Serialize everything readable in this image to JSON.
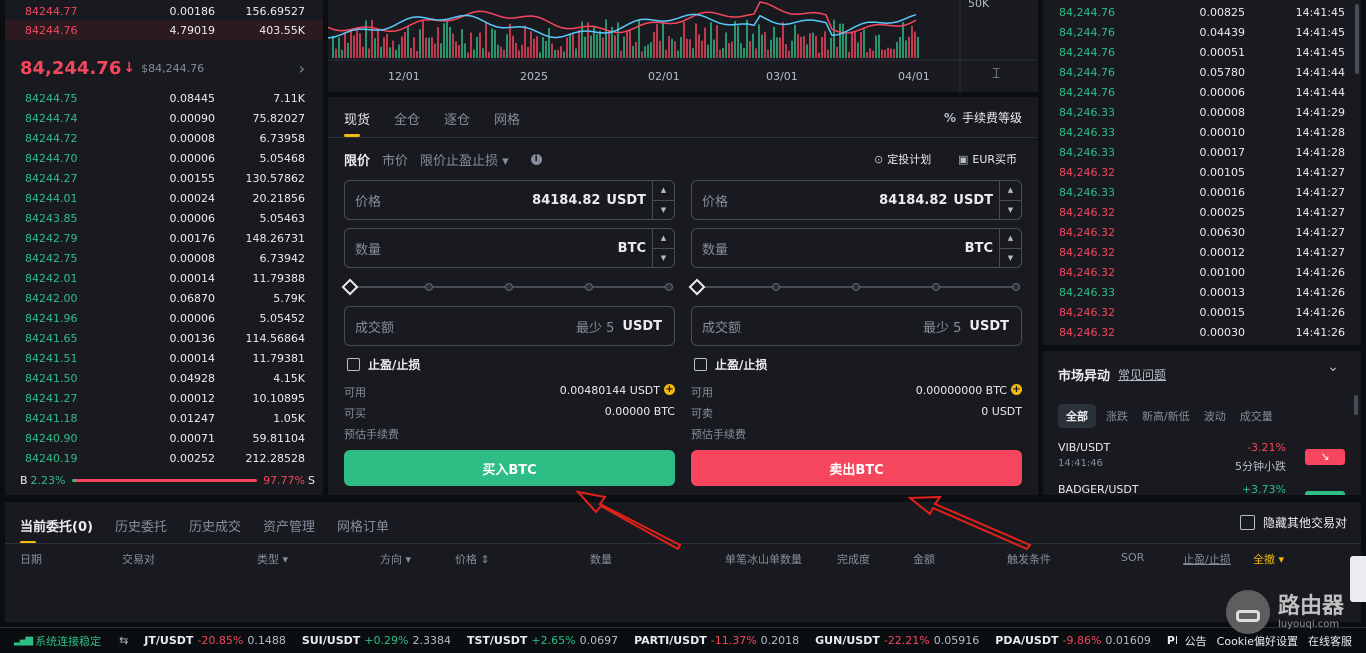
{
  "orderbook": {
    "top_asks": [
      {
        "price": "84244.77",
        "qty": "0.00186",
        "total": "156.69527"
      },
      {
        "price": "84244.76",
        "qty": "4.79019",
        "total": "403.55K"
      }
    ],
    "last_price": "84,244.76",
    "last_arrow": "↓",
    "last_fiat": "$84,244.76",
    "chevron": "›",
    "bids": [
      {
        "price": "84244.75",
        "qty": "0.08445",
        "total": "7.11K"
      },
      {
        "price": "84244.74",
        "qty": "0.00090",
        "total": "75.82027"
      },
      {
        "price": "84244.72",
        "qty": "0.00008",
        "total": "6.73958"
      },
      {
        "price": "84244.70",
        "qty": "0.00006",
        "total": "5.05468"
      },
      {
        "price": "84244.27",
        "qty": "0.00155",
        "total": "130.57862"
      },
      {
        "price": "84244.01",
        "qty": "0.00024",
        "total": "20.21856"
      },
      {
        "price": "84243.85",
        "qty": "0.00006",
        "total": "5.05463"
      },
      {
        "price": "84242.79",
        "qty": "0.00176",
        "total": "148.26731"
      },
      {
        "price": "84242.75",
        "qty": "0.00008",
        "total": "6.73942"
      },
      {
        "price": "84242.01",
        "qty": "0.00014",
        "total": "11.79388"
      },
      {
        "price": "84242.00",
        "qty": "0.06870",
        "total": "5.79K"
      },
      {
        "price": "84241.96",
        "qty": "0.00006",
        "total": "5.05452"
      },
      {
        "price": "84241.65",
        "qty": "0.00136",
        "total": "114.56864"
      },
      {
        "price": "84241.51",
        "qty": "0.00014",
        "total": "11.79381"
      },
      {
        "price": "84241.50",
        "qty": "0.04928",
        "total": "4.15K"
      },
      {
        "price": "84241.27",
        "qty": "0.00012",
        "total": "10.10895"
      },
      {
        "price": "84241.18",
        "qty": "0.01247",
        "total": "1.05K"
      },
      {
        "price": "84240.90",
        "qty": "0.00071",
        "total": "59.81104"
      },
      {
        "price": "84240.19",
        "qty": "0.00252",
        "total": "212.28528"
      }
    ],
    "ratio": {
      "b_label": "B",
      "b_pct": "2.23%",
      "s_pct": "97.77%",
      "s_label": "S",
      "b_fraction": 0.0223
    }
  },
  "chart": {
    "y_label": "50K",
    "x_labels": [
      "12/01",
      "2025",
      "02/01",
      "03/01",
      "04/01"
    ],
    "settings_icon": "⌶",
    "series_ma1_color": "#f6465d",
    "series_ma2_color": "#5ac8fa"
  },
  "trade_form": {
    "tabs": [
      "现货",
      "全仓",
      "逐仓",
      "网格"
    ],
    "fee_label": "手续费等级",
    "order_types": [
      "限价",
      "市价",
      "限价止盈止损 ▾"
    ],
    "dca_label": "定投计划",
    "eur_label": "EUR买币",
    "buy": {
      "price_label": "价格",
      "price_value": "84184.82",
      "price_unit": "USDT",
      "qty_label": "数量",
      "qty_unit": "BTC",
      "total_label": "成交额",
      "total_min": "最少 5",
      "total_unit": "USDT",
      "tpsl_label": "止盈/止损",
      "avail_label": "可用",
      "avail_value": "0.00480144 USDT",
      "max_label": "可买",
      "max_value": "0.00000 BTC",
      "fee_est_label": "预估手续费",
      "button": "买入BTC"
    },
    "sell": {
      "price_label": "价格",
      "price_value": "84184.82",
      "price_unit": "USDT",
      "qty_label": "数量",
      "qty_unit": "BTC",
      "total_label": "成交额",
      "total_min": "最少 5",
      "total_unit": "USDT",
      "tpsl_label": "止盈/止损",
      "avail_label": "可用",
      "avail_value": "0.00000000 BTC",
      "max_label": "可卖",
      "max_value": "0 USDT",
      "fee_est_label": "预估手续费",
      "button": "卖出BTC"
    }
  },
  "trades": [
    {
      "price": "84,244.76",
      "qty": "0.00825",
      "time": "14:41:45",
      "side": "buy"
    },
    {
      "price": "84,244.76",
      "qty": "0.04439",
      "time": "14:41:45",
      "side": "buy"
    },
    {
      "price": "84,244.76",
      "qty": "0.00051",
      "time": "14:41:45",
      "side": "buy"
    },
    {
      "price": "84,244.76",
      "qty": "0.05780",
      "time": "14:41:44",
      "side": "buy"
    },
    {
      "price": "84,244.76",
      "qty": "0.00006",
      "time": "14:41:44",
      "side": "buy"
    },
    {
      "price": "84,246.33",
      "qty": "0.00008",
      "time": "14:41:29",
      "side": "buy"
    },
    {
      "price": "84,246.33",
      "qty": "0.00010",
      "time": "14:41:28",
      "side": "buy"
    },
    {
      "price": "84,246.33",
      "qty": "0.00017",
      "time": "14:41:28",
      "side": "buy"
    },
    {
      "price": "84,246.32",
      "qty": "0.00105",
      "time": "14:41:27",
      "side": "sell"
    },
    {
      "price": "84,246.33",
      "qty": "0.00016",
      "time": "14:41:27",
      "side": "buy"
    },
    {
      "price": "84,246.32",
      "qty": "0.00025",
      "time": "14:41:27",
      "side": "sell"
    },
    {
      "price": "84,246.32",
      "qty": "0.00630",
      "time": "14:41:27",
      "side": "sell"
    },
    {
      "price": "84,246.32",
      "qty": "0.00012",
      "time": "14:41:27",
      "side": "sell"
    },
    {
      "price": "84,246.32",
      "qty": "0.00100",
      "time": "14:41:26",
      "side": "sell"
    },
    {
      "price": "84,246.33",
      "qty": "0.00013",
      "time": "14:41:26",
      "side": "buy"
    },
    {
      "price": "84,246.32",
      "qty": "0.00015",
      "time": "14:41:26",
      "side": "sell"
    },
    {
      "price": "84,246.32",
      "qty": "0.00030",
      "time": "14:41:26",
      "side": "sell"
    }
  ],
  "movers": {
    "title": "市场异动",
    "faq": "常见问题",
    "collapse": "⌄",
    "tabs": [
      "全部",
      "涨跌",
      "新高/新低",
      "波动",
      "成交量"
    ],
    "items": [
      {
        "pair": "VIB/USDT",
        "time": "14:41:46",
        "change": "-3.21%",
        "desc": "5分钟小跌",
        "dir": "down"
      },
      {
        "pair": "BADGER/USDT",
        "change": "+3.73%",
        "dir": "up"
      }
    ]
  },
  "orders": {
    "tabs": [
      "当前委托(0)",
      "历史委托",
      "历史成交",
      "资产管理",
      "网格订单"
    ],
    "hide_other": "隐藏其他交易对",
    "columns": [
      "日期",
      "交易对",
      "类型 ▾",
      "方向 ▾",
      "价格 ⇕",
      "数量",
      "单笔冰山单数量",
      "完成度",
      "金额",
      "触发条件",
      "SOR",
      "止盈/止损",
      "全撤 ▾"
    ]
  },
  "footer": {
    "status": "系统连接稳定",
    "tickers": [
      {
        "pair": "JT/USDT",
        "chg": "-20.85%",
        "price": "0.1488",
        "dir": "down"
      },
      {
        "pair": "SUI/USDT",
        "chg": "+0.29%",
        "price": "2.3384",
        "dir": "up"
      },
      {
        "pair": "TST/USDT",
        "chg": "+2.65%",
        "price": "0.0697",
        "dir": "up"
      },
      {
        "pair": "PARTI/USDT",
        "chg": "-11.37%",
        "price": "0.2018",
        "dir": "down"
      },
      {
        "pair": "GUN/USDT",
        "chg": "-22.21%",
        "price": "0.05916",
        "dir": "down"
      },
      {
        "pair": "PDA/USDT",
        "chg": "-9.86%",
        "price": "0.01609",
        "dir": "down"
      },
      {
        "pair": "PIVX/USD",
        "chg": "",
        "price": "",
        "dir": "down"
      }
    ],
    "announce": "公告",
    "cookie": "Cookie偏好设置",
    "support": "在线客服"
  },
  "watermark": {
    "name": "路由器",
    "url": "luyouqi.com"
  },
  "colors": {
    "green": "#2ebd85",
    "red": "#f6465d",
    "yellow": "#f0b90b",
    "bg": "#0b0e11",
    "panel": "#181a20"
  }
}
